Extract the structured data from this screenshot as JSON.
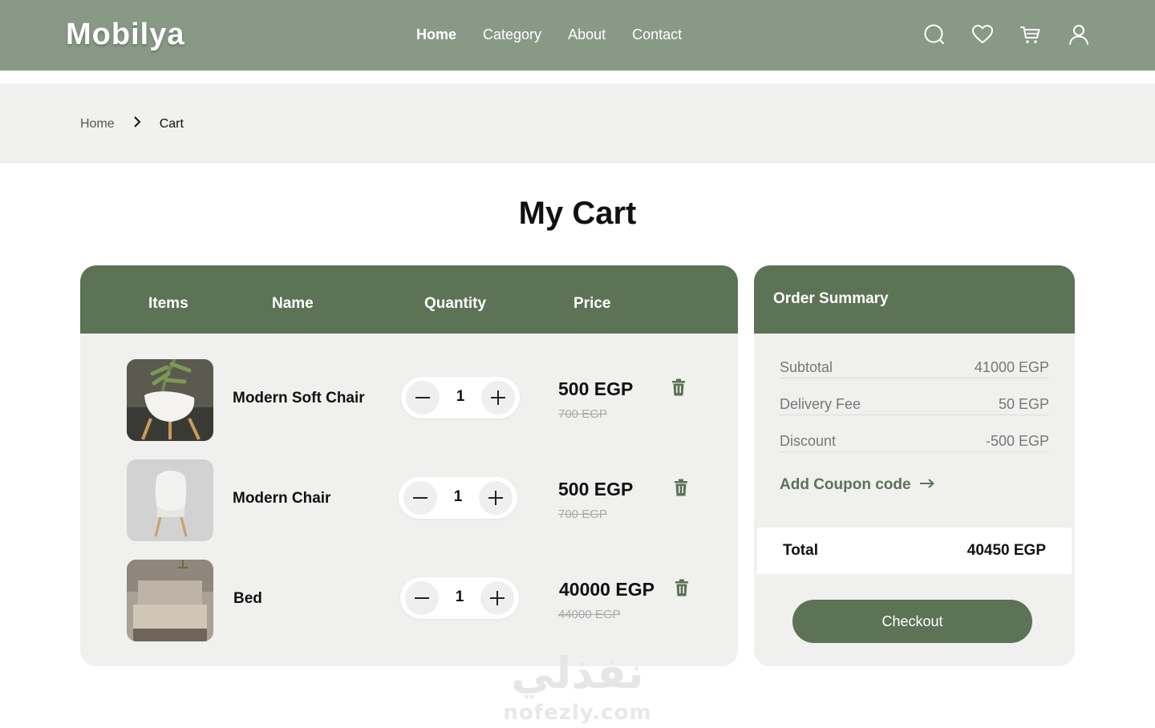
{
  "brand": {
    "name": "Mobilya",
    "accent": "#5c7356",
    "header_bg": "#889a86"
  },
  "nav": {
    "items": [
      {
        "label": "Home",
        "active": true
      },
      {
        "label": "Category"
      },
      {
        "label": "About"
      },
      {
        "label": "Contact"
      }
    ]
  },
  "header_icons": [
    "search-icon",
    "heart-icon",
    "cart-icon",
    "user-icon"
  ],
  "breadcrumb": {
    "home": "Home",
    "current": "Cart"
  },
  "page_title": "My Cart",
  "cart": {
    "columns": [
      "Items",
      "Name",
      "Quantity",
      "Price"
    ],
    "rows": [
      {
        "name": "Modern Soft Chair",
        "quantity": "1",
        "price": "500 EGP",
        "old_price": "700 EGP"
      },
      {
        "name": "Modern Chair",
        "quantity": "1",
        "price": "500 EGP",
        "old_price": "700 EGP"
      },
      {
        "name": "Bed",
        "quantity": "1",
        "price": "40000 EGP",
        "old_price": "44000 EGP"
      }
    ]
  },
  "summary": {
    "title": "Order Summary",
    "subtotal_label": "Subtotal",
    "subtotal_value": "41000 EGP",
    "delivery_label": "Delivery Fee",
    "delivery_value": "50 EGP",
    "discount_label": "Discount",
    "discount_value": "-500 EGP",
    "coupon_label": "Add Coupon code",
    "total_label": "Total",
    "total_value": "40450 EGP",
    "checkout_label": "Checkout"
  },
  "watermark": {
    "arabic": "نفذلي",
    "latin": "nofezly.com"
  }
}
